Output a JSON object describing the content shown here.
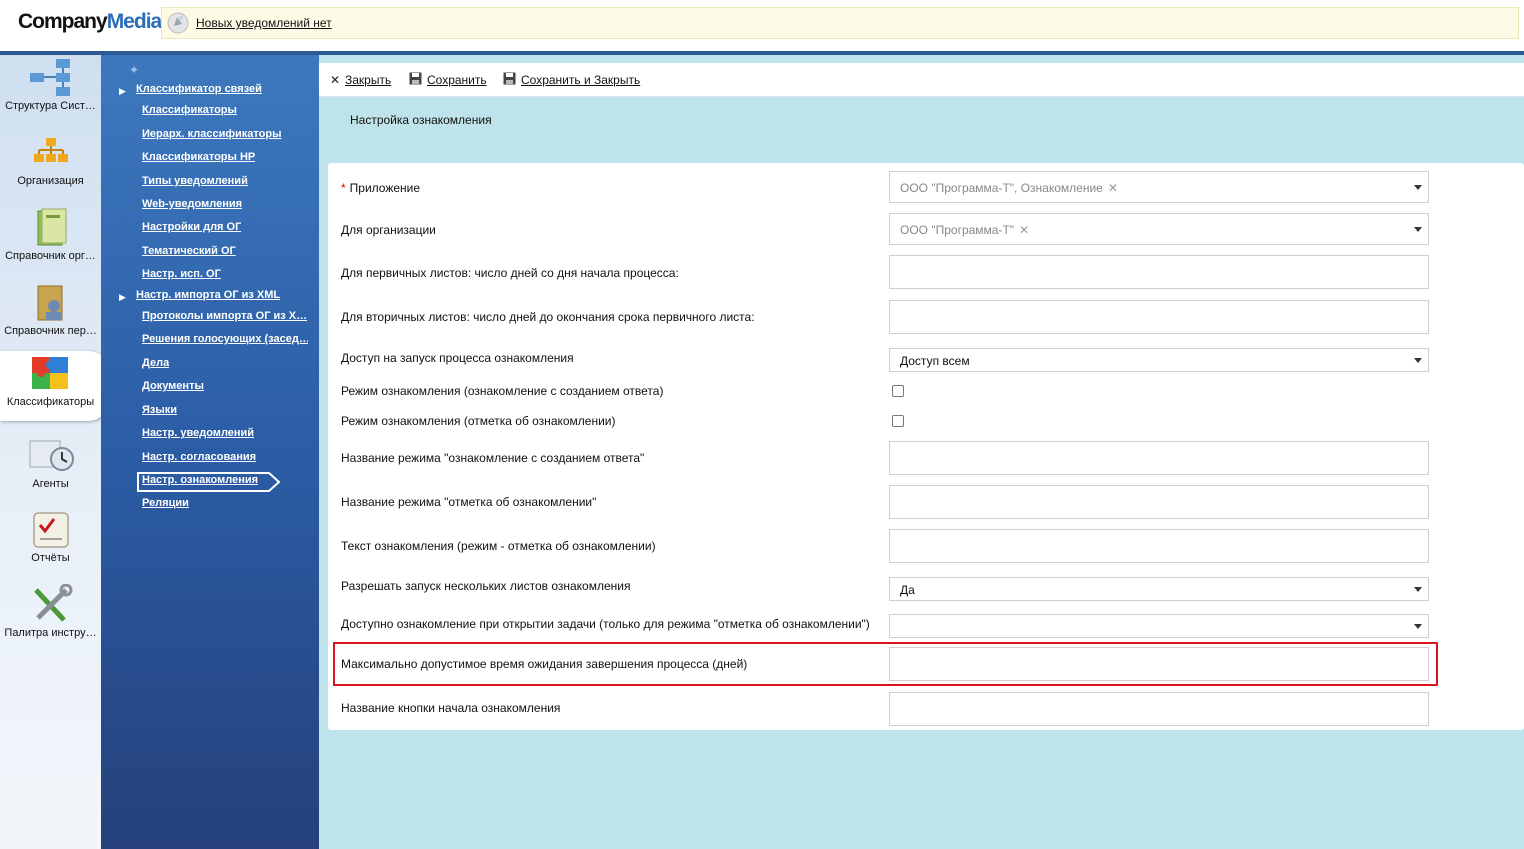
{
  "header": {
    "logo_company": "Company",
    "logo_media": "Media",
    "notification_text": "Новых уведомлений нет"
  },
  "rail": {
    "items": [
      {
        "label": "Структура Сист…",
        "icon": "structure-icon"
      },
      {
        "label": "Организация",
        "icon": "organization-icon"
      },
      {
        "label": "Справочник орг…",
        "icon": "org-directory-icon"
      },
      {
        "label": "Справочник пер…",
        "icon": "personnel-directory-icon"
      },
      {
        "label": "Классификаторы",
        "icon": "puzzle-icon"
      },
      {
        "label": "Агенты",
        "icon": "agents-clock-icon"
      },
      {
        "label": "Отчёты",
        "icon": "reports-icon"
      },
      {
        "label": "Палитра инстру…",
        "icon": "tools-icon"
      }
    ]
  },
  "nav": {
    "items": [
      {
        "label": "Классификатор связей",
        "group": true
      },
      {
        "label": "Классификаторы",
        "group": false
      },
      {
        "label": "Иерарх. классификаторы",
        "group": false
      },
      {
        "label": "Классификаторы НР",
        "group": false
      },
      {
        "label": "Типы уведомлений",
        "group": false
      },
      {
        "label": "Web-уведомления",
        "group": false
      },
      {
        "label": "Настройки для ОГ",
        "group": false
      },
      {
        "label": "Тематический ОГ",
        "group": false
      },
      {
        "label": "Настр. исп. ОГ",
        "group": false
      },
      {
        "label": "Настр. импорта ОГ из XML",
        "group": true
      },
      {
        "label": "Протоколы импорта ОГ из X…",
        "group": false
      },
      {
        "label": "Решения голосующих (засед…",
        "group": false
      },
      {
        "label": "Дела",
        "group": false
      },
      {
        "label": "Документы",
        "group": false
      },
      {
        "label": "Языки",
        "group": false
      },
      {
        "label": "Настр. уведомлений",
        "group": false
      },
      {
        "label": "Настр. согласования",
        "group": false
      },
      {
        "label": "Настр. ознакомления",
        "group": false,
        "active": true
      },
      {
        "label": "Реляции",
        "group": false
      }
    ]
  },
  "toolbar": {
    "close_label": "Закрыть",
    "save_label": "Сохранить",
    "save_close_label": "Сохранить и Закрыть"
  },
  "page": {
    "title": "Настройка ознакомления"
  },
  "form": {
    "application_label": "Приложение",
    "application_value": "ООО \"Программа-Т\", Ознакомление",
    "organization_label": "Для организации",
    "organization_value": "ООО \"Программа-Т\"",
    "primary_days_label": "Для первичных листов: число дней со дня начала процесса:",
    "primary_days_value": "",
    "secondary_days_label": "Для вторичных листов: число дней до окончания срока первичного листа:",
    "secondary_days_value": "",
    "access_label": "Доступ на запуск процесса ознакомления",
    "access_value": "Доступ всем",
    "mode_answer_label": "Режим ознакомления (ознакомление с созданием ответа)",
    "mode_answer_checked": false,
    "mode_mark_label": "Режим ознакомления (отметка об ознакомлении)",
    "mode_mark_checked": false,
    "mode_answer_name_label": "Название режима \"ознакомление с созданием ответа\"",
    "mode_answer_name_value": "",
    "mode_mark_name_label": "Название режима \"отметка об ознакомлении\"",
    "mode_mark_name_value": "",
    "ack_text_label": "Текст ознакомления (режим - отметка об ознакомлении)",
    "ack_text_value": "",
    "multi_launch_label": "Разрешать запуск нескольких листов ознакомления",
    "multi_launch_value": "Да",
    "ack_on_open_label": "Доступно ознакомление при открытии задачи (только для режима \"отметка об ознакомлении\")",
    "ack_on_open_value": "",
    "max_wait_label": "Максимально допустимое время ожидания завершения процесса (дней)",
    "max_wait_value": "",
    "start_button_name_label": "Название кнопки начала ознакомления",
    "start_button_name_value": ""
  },
  "colors": {
    "accent_blue": "#2b5da6",
    "highlight_red": "#d8141c",
    "main_bg": "#bfe3ea"
  }
}
